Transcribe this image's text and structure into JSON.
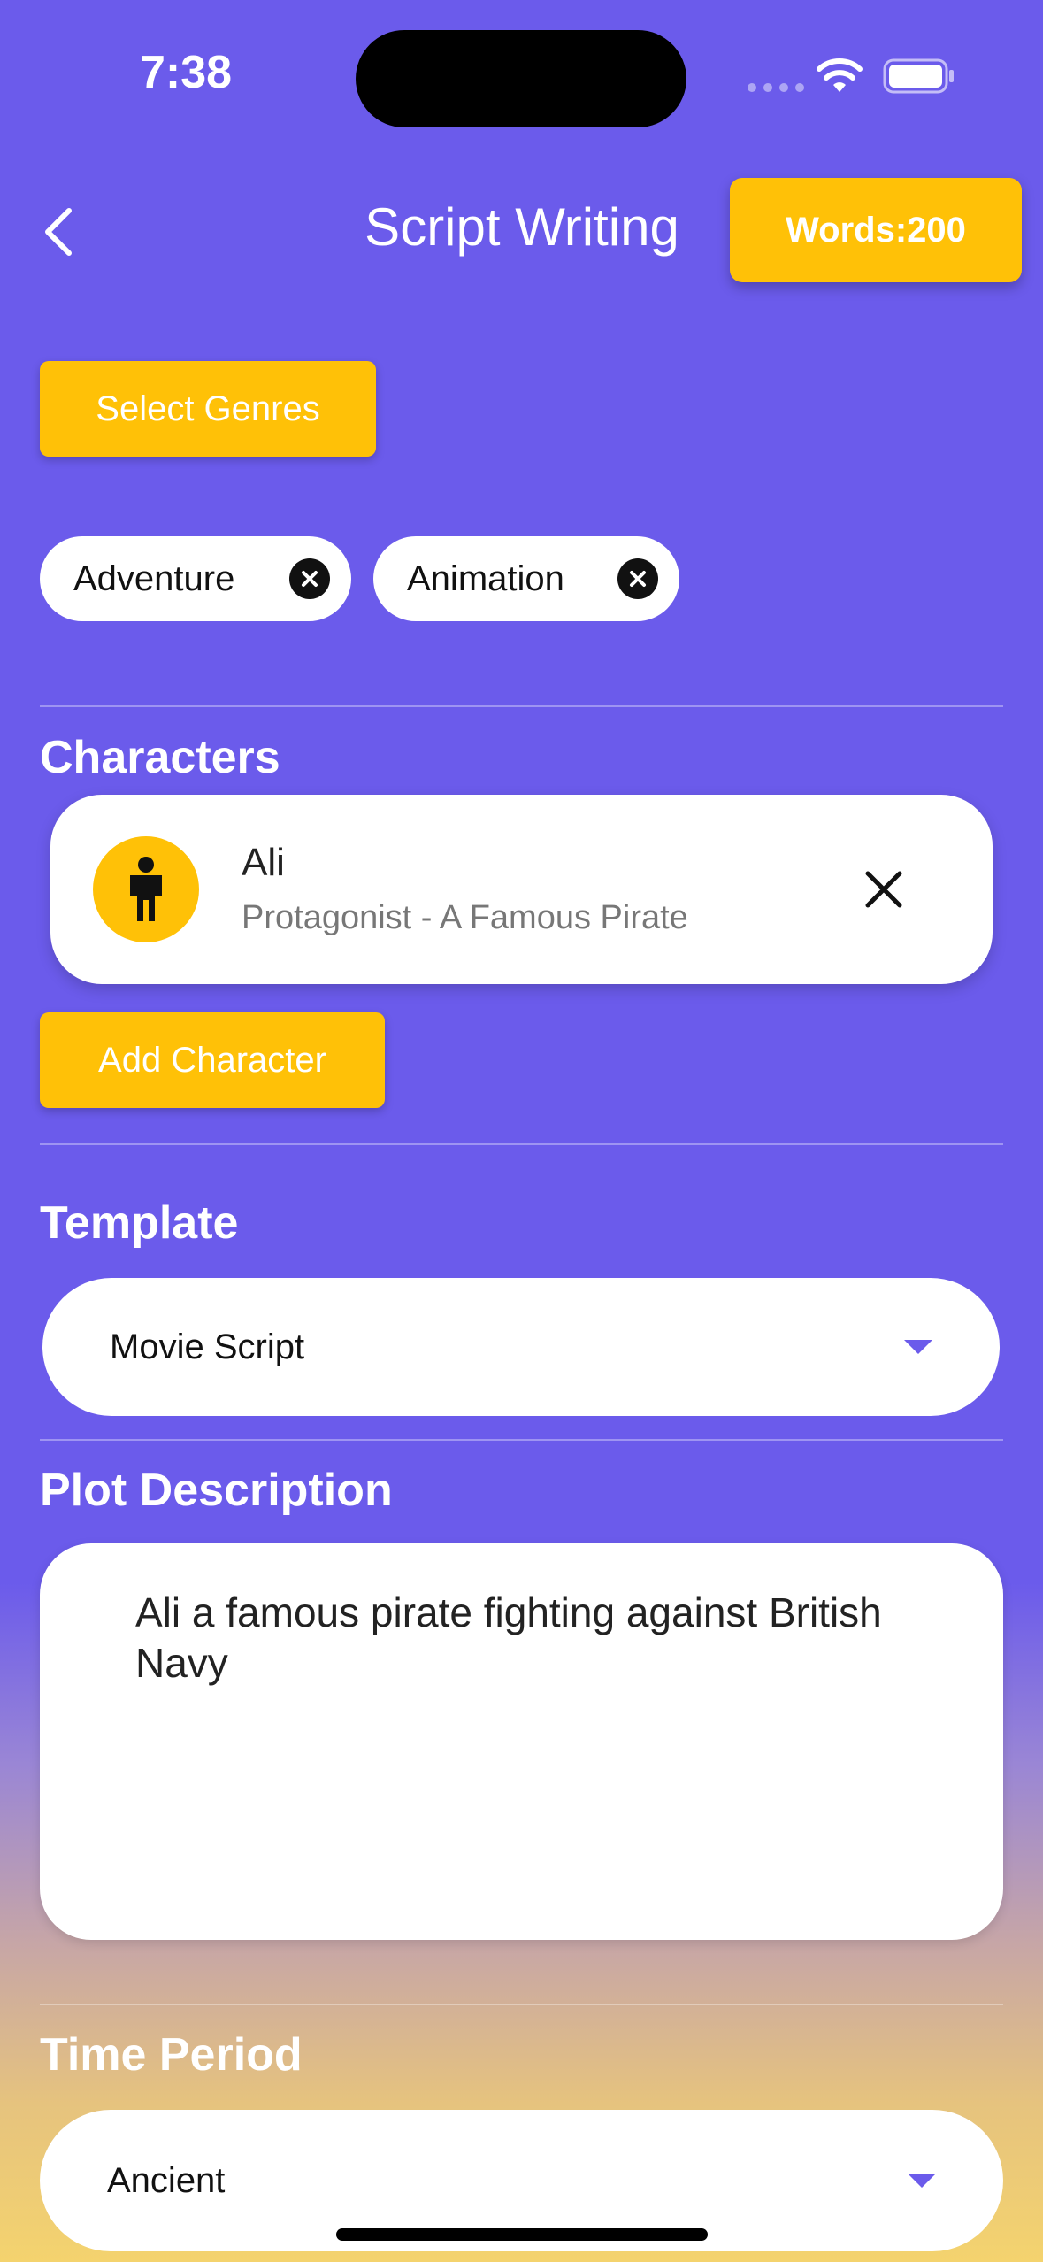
{
  "status_bar": {
    "time": "7:38"
  },
  "header": {
    "title": "Script Writing",
    "words_badge": "Words:200"
  },
  "genres": {
    "select_label": "Select Genres",
    "chips": [
      {
        "label": "Adventure"
      },
      {
        "label": "Animation"
      }
    ]
  },
  "characters": {
    "heading": "Characters",
    "items": [
      {
        "name": "Ali",
        "description": "Protagonist - A Famous Pirate"
      }
    ],
    "add_label": "Add Character"
  },
  "template": {
    "heading": "Template",
    "selected": "Movie Script"
  },
  "plot": {
    "heading": "Plot Description",
    "value": "Ali a famous pirate fighting against British Navy"
  },
  "time_period": {
    "heading": "Time Period",
    "selected": "Ancient"
  },
  "colors": {
    "primary": "#6B5BEB",
    "accent": "#FFC107"
  }
}
